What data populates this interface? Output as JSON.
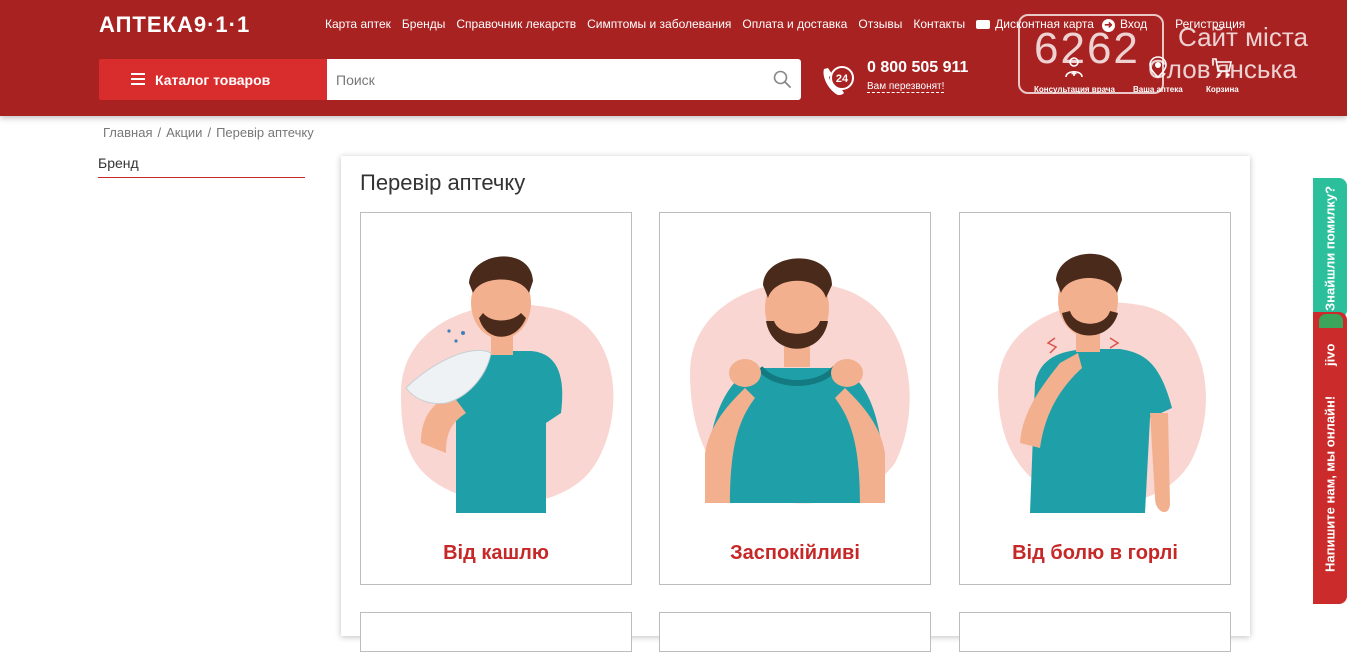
{
  "header": {
    "logo": "АПТЕКА9·1·1",
    "nav": [
      "Карта аптек",
      "Бренды",
      "Справочник лекарств",
      "Симптомы и заболевания",
      "Оплата и доставка",
      "Отзывы",
      "Контакты"
    ],
    "discount_card": "Дисконтная карта",
    "login": "Вход",
    "register": "Регистрация",
    "catalog_button": "Каталог товаров",
    "search_placeholder": "Поиск",
    "phone_badge": "24",
    "phone_number": "0 800 505 911",
    "callback": "Вам перезвонят!",
    "icons": [
      {
        "label": "Консультация врача",
        "icon": "doctor-icon"
      },
      {
        "label": "Ваша аптека",
        "icon": "map-pin-icon"
      },
      {
        "label": "Корзина",
        "icon": "cart-icon"
      }
    ]
  },
  "watermark": {
    "number": "6262",
    "city_line1": "Сайт міста",
    "city_line2": "Слов'янська"
  },
  "breadcrumb": [
    "Главная",
    "Акции",
    "Перевір аптечку"
  ],
  "sidebar": {
    "brand_filter": "Бренд"
  },
  "main": {
    "title": "Перевір аптечку",
    "categories": [
      {
        "label": "Від кашлю",
        "illustration": "man-coughing"
      },
      {
        "label": "Заспокійливі",
        "illustration": "man-calm"
      },
      {
        "label": "Від болю в горлі",
        "illustration": "man-sore-throat"
      }
    ]
  },
  "side_tabs": {
    "error": "Знайшли помилку?",
    "jivo_brand": "jivo",
    "jivo_chat": "Напишите нам, мы онлайн!"
  },
  "colors": {
    "header_bg": "#a82222",
    "catalog_btn": "#d92c2c",
    "accent_red": "#c62828",
    "shirt": "#1fa0a8",
    "blob": "#f9d6d1",
    "error_tab": "#2bbf9b"
  }
}
